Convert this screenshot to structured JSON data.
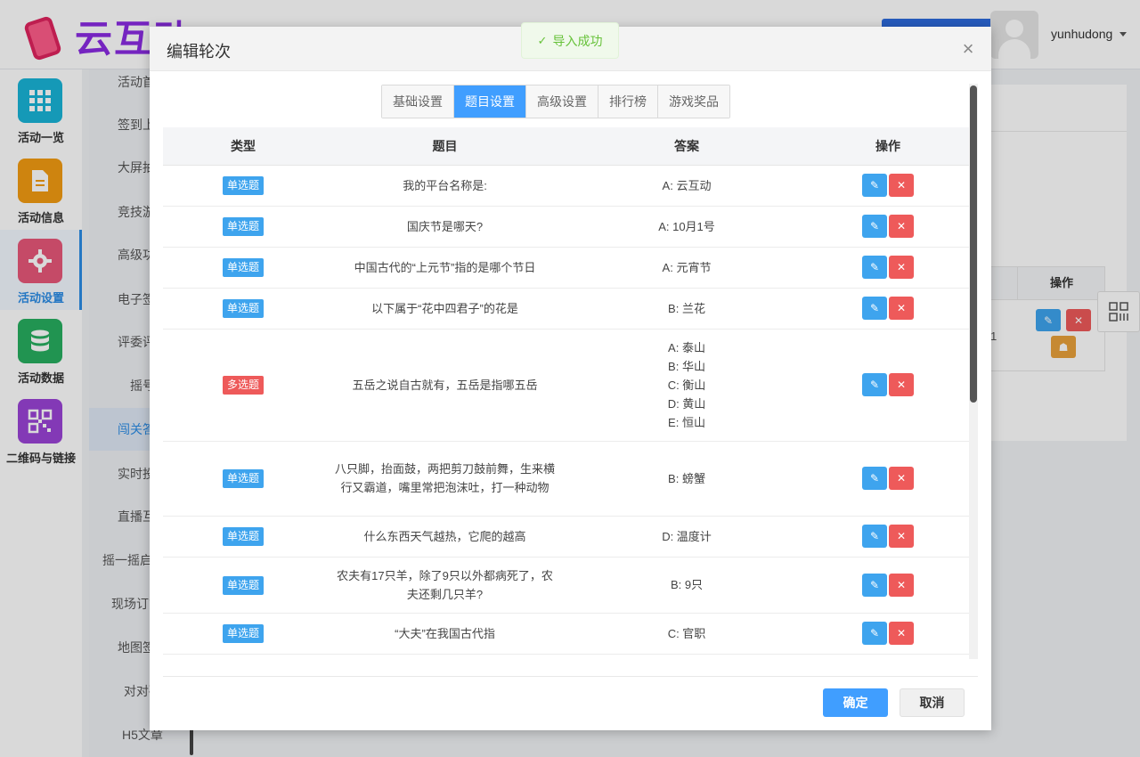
{
  "app": {
    "logo_text": "云互动",
    "username": "yunhudong",
    "user_menu_icon": "caret-down-icon"
  },
  "leftnav": {
    "items": [
      {
        "label": "活动一览",
        "icon": "grid-icon",
        "color": "#19b4d8"
      },
      {
        "label": "活动信息",
        "icon": "document-icon",
        "color": "#f39c12"
      },
      {
        "label": "活动设置",
        "icon": "gear-icon",
        "color": "#e8577a",
        "active": true
      },
      {
        "label": "活动数据",
        "icon": "database-icon",
        "color": "#27ae60"
      },
      {
        "label": "二维码与链接",
        "icon": "qrcode-icon",
        "color": "#9b44d6"
      }
    ]
  },
  "subnav": {
    "items": [
      "活动首页",
      "签到上墙",
      "大屏抽奖",
      "竞技游戏",
      "高级功能",
      "电子签名",
      "评委评分",
      "摇号",
      "闯关答题",
      "实时投票",
      "直播互动",
      "摇一摇启动",
      "现场订货",
      "地图签到",
      "对对碰",
      "H5文章"
    ]
  },
  "background_table": {
    "header_action": "操作",
    "row_num": "1"
  },
  "toast": {
    "text": "导入成功"
  },
  "modal": {
    "title": "编辑轮次",
    "tabs": [
      "基础设置",
      "题目设置",
      "高级设置",
      "排行榜",
      "游戏奖品"
    ],
    "active_tab": "题目设置",
    "columns": [
      "类型",
      "题目",
      "答案",
      "操作"
    ],
    "rows": [
      {
        "type": "单选题",
        "kind": "single",
        "question": "我的平台名称是:",
        "answers": [
          "A: 云互动"
        ]
      },
      {
        "type": "单选题",
        "kind": "single",
        "question": "国庆节是哪天?",
        "answers": [
          "A: 10月1号"
        ]
      },
      {
        "type": "单选题",
        "kind": "single",
        "question": "中国古代的“上元节”指的是哪个节日",
        "answers": [
          "A: 元宵节"
        ]
      },
      {
        "type": "单选题",
        "kind": "single",
        "question": "以下属于“花中四君子”的花是",
        "answers": [
          "B: 兰花"
        ]
      },
      {
        "type": "多选题",
        "kind": "multi",
        "question": "五岳之说自古就有，五岳是指哪五岳",
        "answers": [
          "A: 泰山",
          "B: 华山",
          "C: 衡山",
          "D: 黄山",
          "E: 恒山"
        ]
      },
      {
        "type": "单选题",
        "kind": "single",
        "question": "八只脚，抬面鼓，两把剪刀鼓前舞，生来横行又霸道，嘴里常把泡沫吐，打一种动物",
        "answers": [
          "B: 螃蟹"
        ]
      },
      {
        "type": "单选题",
        "kind": "single",
        "question": "什么东西天气越热，它爬的越高",
        "answers": [
          "D: 温度计"
        ]
      },
      {
        "type": "单选题",
        "kind": "single",
        "question": "农夫有17只羊，除了9只以外都病死了，农夫还剩几只羊?",
        "answers": [
          "B: 9只"
        ]
      },
      {
        "type": "单选题",
        "kind": "single",
        "question": "“大夫”在我国古代指",
        "answers": [
          "C: 官职"
        ]
      }
    ],
    "edit_icon": "pencil-icon",
    "delete_icon": "close-icon",
    "ok_label": "确定",
    "cancel_label": "取消"
  }
}
